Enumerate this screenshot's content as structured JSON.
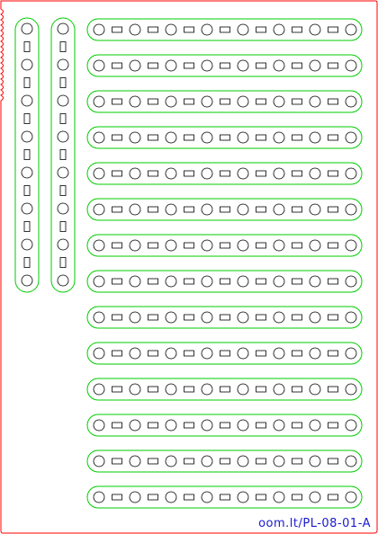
{
  "sheet": {
    "label": "oom.lt/PL-08-01-A",
    "outline_color": "#ff0000",
    "part_color": "#00cc00",
    "cutout_color": "#000000",
    "label_color": "#1a1ad0",
    "background": "#ffffff"
  },
  "parts": {
    "vertical_beam_count": 2,
    "vertical_beam_holes": [
      "round",
      "slot",
      "round",
      "slot",
      "round",
      "slot",
      "round",
      "slot",
      "round",
      "slot",
      "round",
      "slot",
      "round",
      "slot",
      "round"
    ],
    "horizontal_beam_count": 14,
    "horizontal_beam_holes": [
      "round",
      "slot",
      "round",
      "slot",
      "round",
      "slot",
      "round",
      "slot",
      "round",
      "slot",
      "round",
      "slot",
      "round",
      "slot",
      "round"
    ]
  }
}
